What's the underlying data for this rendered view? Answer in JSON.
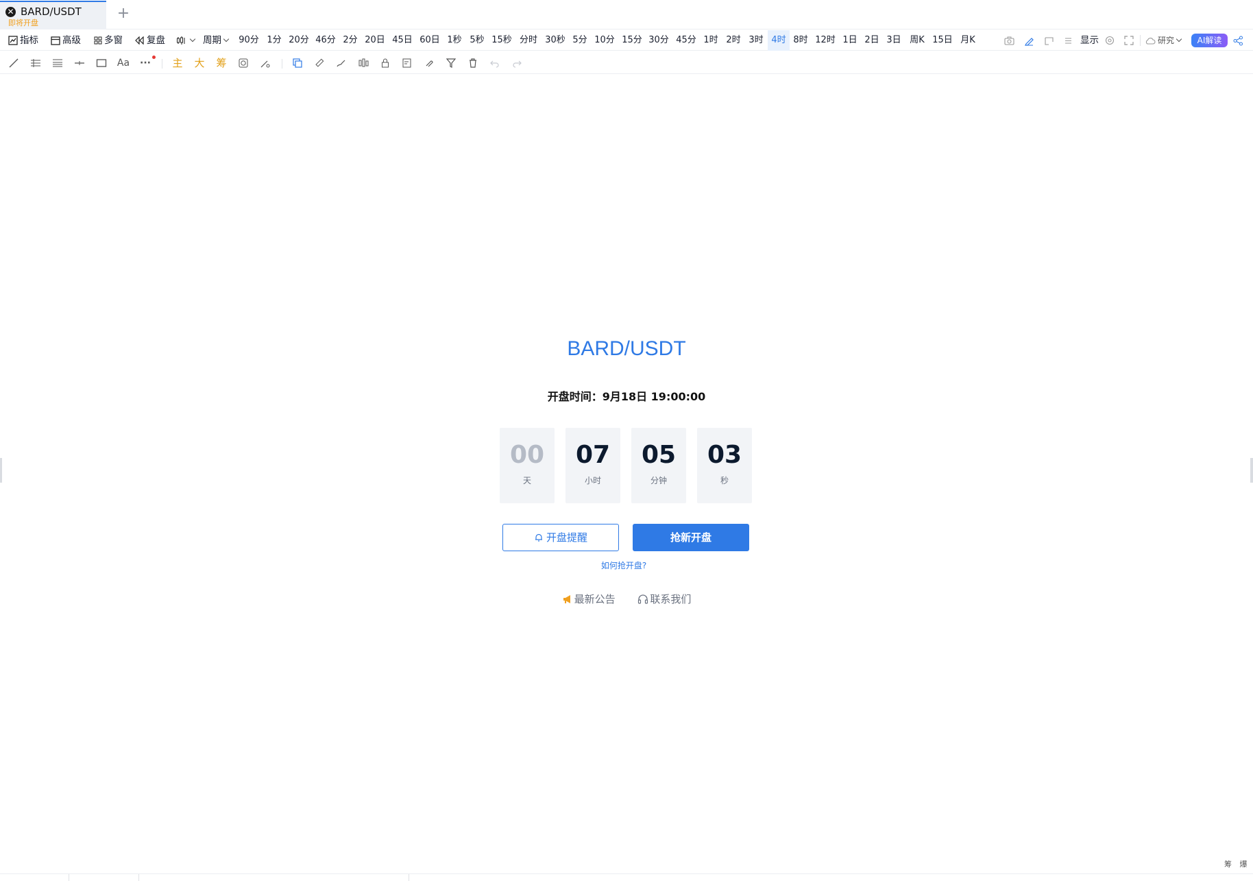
{
  "tab": {
    "symbol": "BARD/USDT",
    "status": "即将开盘",
    "add_label": "+"
  },
  "toolbar": {
    "indicators_label": "指标",
    "advanced_label": "高级",
    "multi_window_label": "多窗",
    "replay_label": "复盘",
    "period_label": "周期",
    "periods": [
      "90分",
      "1分",
      "20分",
      "46分",
      "2分",
      "20日",
      "45日",
      "60日",
      "1秒",
      "5秒",
      "15秒",
      "分时",
      "30秒",
      "5分",
      "10分",
      "15分",
      "30分",
      "45分",
      "1时",
      "2时",
      "3时",
      "4时",
      "8时",
      "12时",
      "1日",
      "2日",
      "3日",
      "周K",
      "15日",
      "月K"
    ],
    "active_period": "4时",
    "display_label": "显示",
    "research_label": "研究",
    "ai_label": "AI解读"
  },
  "drawing_tools": {
    "text_tool_label": "Aa",
    "more_label": "···",
    "main_label": "主",
    "big_label": "大",
    "chip_label": "筹"
  },
  "listing": {
    "pair": "BARD/USDT",
    "open_time": "开盘时间：9月18日 19:00:00",
    "countdown": [
      {
        "value": "00",
        "unit": "天"
      },
      {
        "value": "07",
        "unit": "小时"
      },
      {
        "value": "05",
        "unit": "分钟"
      },
      {
        "value": "03",
        "unit": "秒"
      }
    ],
    "remind_label": "开盘提醒",
    "grab_label": "抢新开盘",
    "how_label": "如何抢开盘?",
    "news_label": "最新公告",
    "contact_label": "联系我们"
  },
  "corner_text": "筹 爆",
  "colors": {
    "accent": "#2f7ae5",
    "status_orange": "#f0a020",
    "box_bg": "#f2f4f7"
  }
}
